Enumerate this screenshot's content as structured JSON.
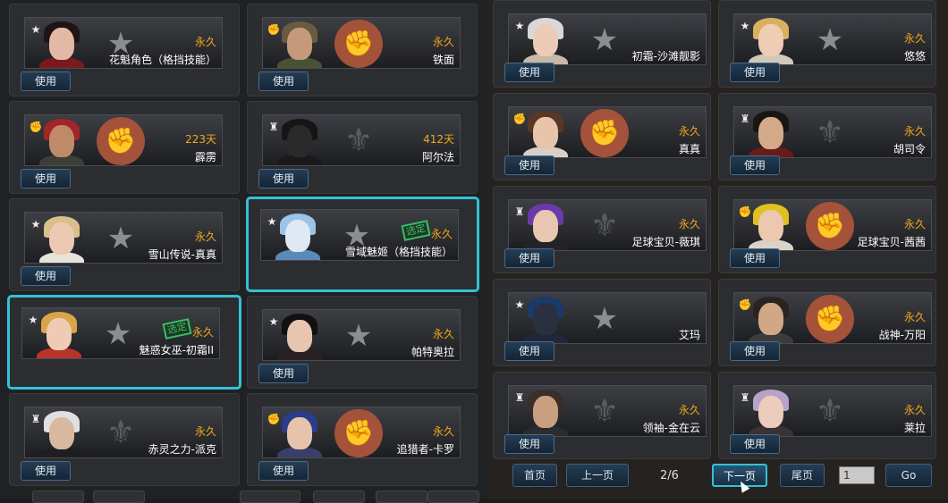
{
  "use_label": "使用",
  "selected_label": "选定",
  "left_cards": [
    {
      "duration": "永久",
      "name": "花魁角色（格挡技能）",
      "badge": "star-badge-icon",
      "emblem": "star-emblem-icon",
      "selected": false,
      "stamp": false,
      "hair": "#1e1414",
      "skin": "#e2b9a4",
      "body": "#7a1a1e"
    },
    {
      "duration": "永久",
      "name": "铁面",
      "badge": "fist-badge-icon",
      "emblem": "fist-emblem-icon",
      "selected": false,
      "stamp": false,
      "hair": "#6a5a40",
      "skin": "#c49a7a",
      "body": "#4a5236"
    },
    {
      "duration": "223天",
      "name": "霹雳",
      "badge": "fist-badge-icon",
      "emblem": "fist-emblem-icon",
      "selected": false,
      "stamp": false,
      "hair": "#a0262a",
      "skin": "#c08a6a",
      "body": "#3c3f36"
    },
    {
      "duration": "412天",
      "name": "阿尔法",
      "badge": "wing-badge-icon",
      "emblem": "wing-emblem-icon",
      "selected": false,
      "stamp": false,
      "hair": "#151515",
      "skin": "#2a2a2a",
      "body": "#1a1a1a"
    },
    {
      "duration": "永久",
      "name": "雪山传说-真真",
      "badge": "star-badge-icon",
      "emblem": "star-emblem-icon",
      "selected": false,
      "stamp": false,
      "hair": "#d9c08a",
      "skin": "#ecc9b2",
      "body": "#e8e4dc"
    },
    {
      "duration": "永久",
      "name": "雪域魅姬（格挡技能）",
      "badge": "star-badge-icon",
      "emblem": "star-emblem-icon",
      "selected": true,
      "stamp": true,
      "hair": "#9ac4e8",
      "skin": "#dfe8f3",
      "body": "#5a8ab8"
    },
    {
      "duration": "永久",
      "name": "魅惑女巫-初霜II",
      "badge": "star-badge-icon",
      "emblem": "star-emblem-icon",
      "selected": true,
      "stamp": true,
      "hair": "#d8a54a",
      "skin": "#efcbb4",
      "body": "#b8342a"
    },
    {
      "duration": "永久",
      "name": "帕特奥拉",
      "badge": "star-badge-icon",
      "emblem": "star-emblem-icon",
      "selected": false,
      "stamp": false,
      "hair": "#111111",
      "skin": "#e8c5b0",
      "body": "#2a2024"
    },
    {
      "duration": "永久",
      "name": "赤灵之力-派克",
      "badge": "wing-badge-icon",
      "emblem": "wing-emblem-icon",
      "selected": false,
      "stamp": false,
      "hair": "#e0e0e0",
      "skin": "#d9b8a0",
      "body": "#1e1e22"
    },
    {
      "duration": "永久",
      "name": "追猎者-卡罗",
      "badge": "fist-badge-icon",
      "emblem": "fist-emblem-icon",
      "selected": false,
      "stamp": false,
      "hair": "#2a3c8a",
      "skin": "#e6c4ac",
      "body": "#3a3e6a"
    }
  ],
  "right_cards": [
    {
      "duration": "",
      "name": "初霜-沙滩靓影",
      "badge": "star-badge-icon",
      "emblem": "star-emblem-icon",
      "hair": "#d8d8d8",
      "skin": "#ecccb6",
      "body": "#c8b8a8"
    },
    {
      "duration": "永久",
      "name": "悠悠",
      "badge": "star-badge-icon",
      "emblem": "star-emblem-icon",
      "hair": "#d9b060",
      "skin": "#efcdb4",
      "body": "#d0c8b8"
    },
    {
      "duration": "永久",
      "name": "真真",
      "badge": "fist-badge-icon",
      "emblem": "fist-emblem-icon",
      "hair": "#5a3626",
      "skin": "#e8c4aa",
      "body": "#d8d0c8"
    },
    {
      "duration": "永久",
      "name": "胡司令",
      "badge": "wing-badge-icon",
      "emblem": "wing-emblem-icon",
      "hair": "#1a1614",
      "skin": "#d4aa8a",
      "body": "#6a1a18"
    },
    {
      "duration": "永久",
      "name": "足球宝贝-薇琪",
      "badge": "wing-badge-icon",
      "emblem": "wing-emblem-icon",
      "hair": "#6a3aa8",
      "skin": "#e8c6b0",
      "body": "#242428"
    },
    {
      "duration": "永久",
      "name": "足球宝贝-茜茜",
      "badge": "fist-badge-icon",
      "emblem": "fist-emblem-icon",
      "hair": "#e0c020",
      "skin": "#ecc8b0",
      "body": "#d8d4c8"
    },
    {
      "duration": "",
      "name": "艾玛",
      "badge": "star-badge-icon",
      "emblem": "star-emblem-icon",
      "hair": "#1a3a6a",
      "skin": "#2a3040",
      "body": "#202838"
    },
    {
      "duration": "永久",
      "name": "战神-万阳",
      "badge": "fist-badge-icon",
      "emblem": "fist-emblem-icon",
      "hair": "#2a2420",
      "skin": "#d0a888",
      "body": "#3c3c3a"
    },
    {
      "duration": "永久",
      "name": "领袖-金在云",
      "badge": "wing-badge-icon",
      "emblem": "wing-emblem-icon",
      "hair": "#3a2e28",
      "skin": "#c8a080",
      "body": "#2a2c2e"
    },
    {
      "duration": "永久",
      "name": "莱拉",
      "badge": "wing-badge-icon",
      "emblem": "wing-emblem-icon",
      "hair": "#b8a2c8",
      "skin": "#ecccbc",
      "body": "#3a3236"
    }
  ],
  "pager": {
    "first": "首页",
    "prev": "上一页",
    "page_indicator": "2/6",
    "next": "下一页",
    "last": "尾页",
    "input_value": "1",
    "go": "Go"
  },
  "colors": {
    "duration": "#f0a81c",
    "selected_border": "#33c2d6",
    "stamp": "#36c060"
  }
}
